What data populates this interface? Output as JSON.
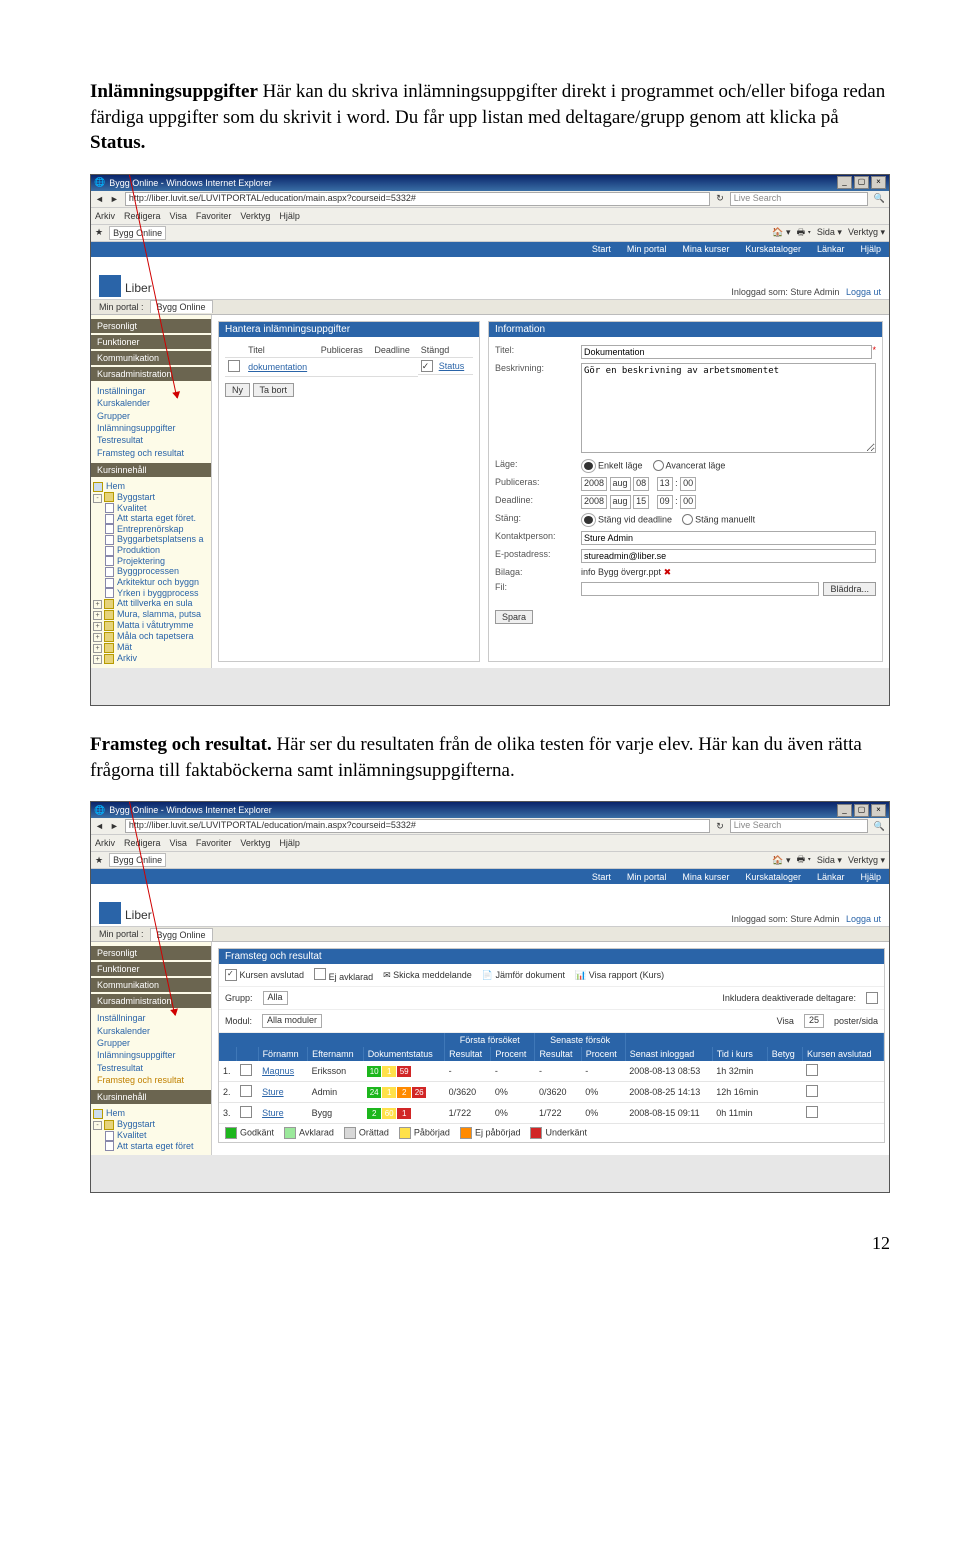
{
  "para1": {
    "strong": "Inlämningsuppgifter",
    "rest": " Här kan du skriva inlämningsuppgifter direkt i programmet och/eller bifoga redan färdiga uppgifter som du skrivit i word. Du får upp listan med deltagare/grupp genom att klicka på ",
    "strong2": "Status."
  },
  "para2": {
    "strong": "Framsteg och resultat.",
    "rest": " Här ser du resultaten från de olika testen för varje elev. Här kan du även rätta frågorna till faktaböckerna samt inlämningsuppgifterna."
  },
  "page_number": "12",
  "win": {
    "title": "Bygg Online - Windows Internet Explorer",
    "url": "http://liber.luvit.se/LUVITPORTAL/education/main.aspx?courseid=5332#",
    "search_ph": "Live Search",
    "menu": [
      "Arkiv",
      "Redigera",
      "Visa",
      "Favoriter",
      "Verktyg",
      "Hjälp"
    ],
    "tab": "Bygg Online",
    "tools": {
      "sida": "Sida",
      "verktyg": "Verktyg"
    }
  },
  "nav": [
    "Start",
    "Min portal",
    "Mina kurser",
    "Kurskataloger",
    "Länkar",
    "Hjälp"
  ],
  "liber": {
    "name": "Liber",
    "breadcrumb_prefix": "Min portal :",
    "breadcrumb_course": "Bygg Online",
    "logged_prefix": "Inloggad som:",
    "logged_user": "Sture Admin",
    "logout": "Logga ut"
  },
  "left_sections": [
    "Personligt",
    "Funktioner",
    "Kommunikation",
    "Kursadministration"
  ],
  "left_admin_items": [
    "Inställningar",
    "Kurskalender",
    "Grupper",
    "Inlämningsuppgifter",
    "Testresultat",
    "Framsteg och resultat"
  ],
  "left_content_header": "Kursinnehåll",
  "tree": [
    {
      "lbl": "Hem",
      "lvl": 0,
      "icon": "home"
    },
    {
      "lbl": "Byggstart",
      "lvl": 0,
      "icon": "folder",
      "pm": "-"
    },
    {
      "lbl": "Kvalitet",
      "lvl": 1,
      "icon": "page"
    },
    {
      "lbl": "Att starta eget föret.",
      "lvl": 1,
      "icon": "page"
    },
    {
      "lbl": "Entreprenörskap",
      "lvl": 1,
      "icon": "page"
    },
    {
      "lbl": "Byggarbetsplatsens a",
      "lvl": 1,
      "icon": "page"
    },
    {
      "lbl": "Produktion",
      "lvl": 1,
      "icon": "page"
    },
    {
      "lbl": "Projektering",
      "lvl": 1,
      "icon": "page"
    },
    {
      "lbl": "Byggprocessen",
      "lvl": 1,
      "icon": "page"
    },
    {
      "lbl": "Arkitektur och byggn",
      "lvl": 1,
      "icon": "page"
    },
    {
      "lbl": "Yrken i byggprocess",
      "lvl": 1,
      "icon": "page"
    },
    {
      "lbl": "Att tillverka en sula",
      "lvl": 0,
      "icon": "folder",
      "pm": "+"
    },
    {
      "lbl": "Mura, slamma, putsa",
      "lvl": 0,
      "icon": "folder",
      "pm": "+"
    },
    {
      "lbl": "Matta i våtutrymme",
      "lvl": 0,
      "icon": "folder",
      "pm": "+"
    },
    {
      "lbl": "Måla och tapetsera",
      "lvl": 0,
      "icon": "folder",
      "pm": "+"
    },
    {
      "lbl": "Mät",
      "lvl": 0,
      "icon": "folder",
      "pm": "+"
    },
    {
      "lbl": "Arkiv",
      "lvl": 0,
      "icon": "folder",
      "pm": "+"
    }
  ],
  "ss1": {
    "left_hdr": "Hantera inlämningsuppgifter",
    "cols": [
      "",
      "Titel",
      "Publiceras",
      "Deadline",
      "Stängd"
    ],
    "row": {
      "title": "dokumentation",
      "status": "Status"
    },
    "btn_new": "Ny",
    "btn_del": "Ta bort",
    "right_hdr": "Information",
    "lbl_title": "Titel:",
    "v_title": "Dokumentation",
    "lbl_desc": "Beskrivning:",
    "v_desc": "Gör en beskrivning av arbetsmomentet",
    "lbl_mode": "Läge:",
    "mode_simple": "Enkelt läge",
    "mode_adv": "Avancerat läge",
    "lbl_pub": "Publiceras:",
    "pub": [
      "2008",
      "aug",
      "08",
      "13",
      "00"
    ],
    "lbl_deadline": "Deadline:",
    "deadline": [
      "2008",
      "aug",
      "15",
      "09",
      "00"
    ],
    "lbl_close": "Stäng:",
    "close_at": "Stäng vid deadline",
    "close_man": "Stäng manuellt",
    "lbl_contact": "Kontaktperson:",
    "v_contact": "Sture Admin",
    "lbl_email": "E-postadress:",
    "v_email": "stureadmin@liber.se",
    "lbl_attach": "Bilaga:",
    "v_attach": "info Bygg övergr.ppt",
    "lbl_file": "Fil:",
    "btn_browse": "Bläddra...",
    "btn_save": "Spara"
  },
  "ss2": {
    "hdr": "Framsteg och resultat",
    "tb": {
      "done": "Kursen avslutad",
      "notdone": "Ej avklarad",
      "msg": "Skicka meddelande",
      "cmp": "Jämför dokument",
      "rpt": "Visa rapport (Kurs)"
    },
    "filters": {
      "group": "Grupp:",
      "group_v": "Alla",
      "incl": "Inkludera deaktiverade deltagare:",
      "module": "Modul:",
      "module_v": "Alla moduler",
      "show": "Visa",
      "show_v": "25",
      "show_suffix": "poster/sida"
    },
    "colgrp": {
      "first": "Första försöket",
      "last": "Senaste försök"
    },
    "cols": [
      "",
      "",
      "Förnamn",
      "Efternamn",
      "Dokumentstatus",
      "Resultat",
      "Procent",
      "Resultat",
      "Procent",
      "Senast inloggad",
      "Tid i kurs",
      "Betyg",
      "Kursen avslutad"
    ],
    "rows": [
      {
        "n": "1.",
        "first": "Magnus",
        "last": "Eriksson",
        "doc": [
          [
            "10",
            "#1db61d"
          ],
          [
            "1",
            "#ffe14a"
          ],
          [
            "59",
            "#d12626"
          ]
        ],
        "r1": "-",
        "p1": "-",
        "r2": "-",
        "p2": "-",
        "login": "2008-08-13 08:53",
        "time": "1h 32min"
      },
      {
        "n": "2.",
        "first": "Sture",
        "last": "Admin",
        "doc": [
          [
            "24",
            "#1db61d"
          ],
          [
            "1",
            "#ffe14a"
          ],
          [
            "2",
            "#ff8a00"
          ],
          [
            "26",
            "#d12626"
          ]
        ],
        "r1": "0/3620",
        "p1": "0%",
        "r2": "0/3620",
        "p2": "0%",
        "login": "2008-08-25 14:13",
        "time": "12h 16min"
      },
      {
        "n": "3.",
        "first": "Sture",
        "last": "Bygg",
        "doc": [
          [
            "2",
            "#1db61d"
          ],
          [
            "60",
            "#ffe14a"
          ],
          [
            "1",
            "#d12626"
          ]
        ],
        "r1": "1/722",
        "p1": "0%",
        "r2": "1/722",
        "p2": "0%",
        "login": "2008-08-15 09:11",
        "time": "0h 11min"
      }
    ],
    "legend": [
      {
        "lbl": "Godkänt",
        "c": "#1db61d"
      },
      {
        "lbl": "Avklarad",
        "c": "#9be89b"
      },
      {
        "lbl": "Orättad",
        "c": "#d8d8d8"
      },
      {
        "lbl": "Påbörjad",
        "c": "#ffe14a"
      },
      {
        "lbl": "Ej påbörjad",
        "c": "#ff8a00"
      },
      {
        "lbl": "Underkänt",
        "c": "#d12626"
      }
    ]
  },
  "tree2": [
    {
      "lbl": "Hem",
      "lvl": 0,
      "icon": "home"
    },
    {
      "lbl": "Byggstart",
      "lvl": 0,
      "icon": "folder",
      "pm": "-"
    },
    {
      "lbl": "Kvalitet",
      "lvl": 1,
      "icon": "page"
    },
    {
      "lbl": "Att starta eget föret",
      "lvl": 1,
      "icon": "page"
    }
  ]
}
